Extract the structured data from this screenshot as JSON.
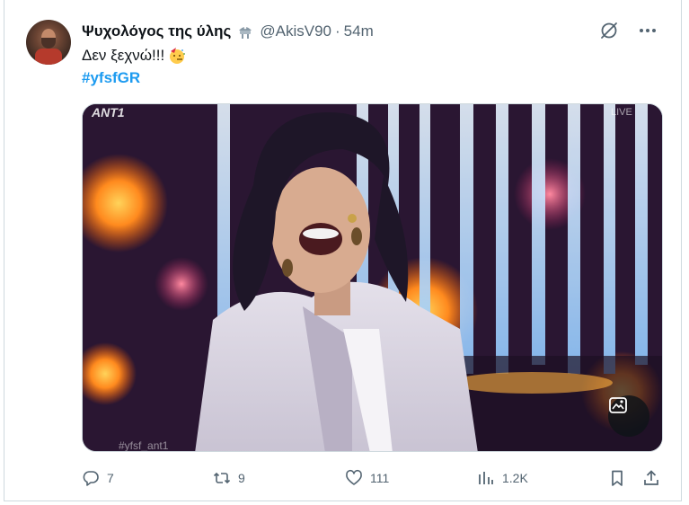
{
  "tweet": {
    "display_name": "Ψυχολόγος της ύλης",
    "handle": "@AkisV90",
    "separator": "·",
    "time": "54m",
    "text": "Δεν ξεχνώ!!!",
    "hashtag": "#yfsfGR"
  },
  "media": {
    "channel_logo": "ANT1",
    "live_label": "LIVE",
    "watermark": "#yfsf_ant1"
  },
  "actions": {
    "replies": "7",
    "reposts": "9",
    "likes": "111",
    "views": "1.2K"
  },
  "icons": {
    "verified": "robot-badge-icon",
    "grok": "grok-icon",
    "more": "more-icon",
    "emoji": "party-face-emoji",
    "media_button": "image-edit-icon",
    "reply": "reply-icon",
    "repost": "repost-icon",
    "like": "like-icon",
    "views": "views-icon",
    "bookmark": "bookmark-icon",
    "share": "share-icon"
  },
  "colors": {
    "link": "#1d9bf0",
    "secondary_text": "#536471",
    "primary_text": "#0f1419",
    "border": "#cfd9de"
  }
}
